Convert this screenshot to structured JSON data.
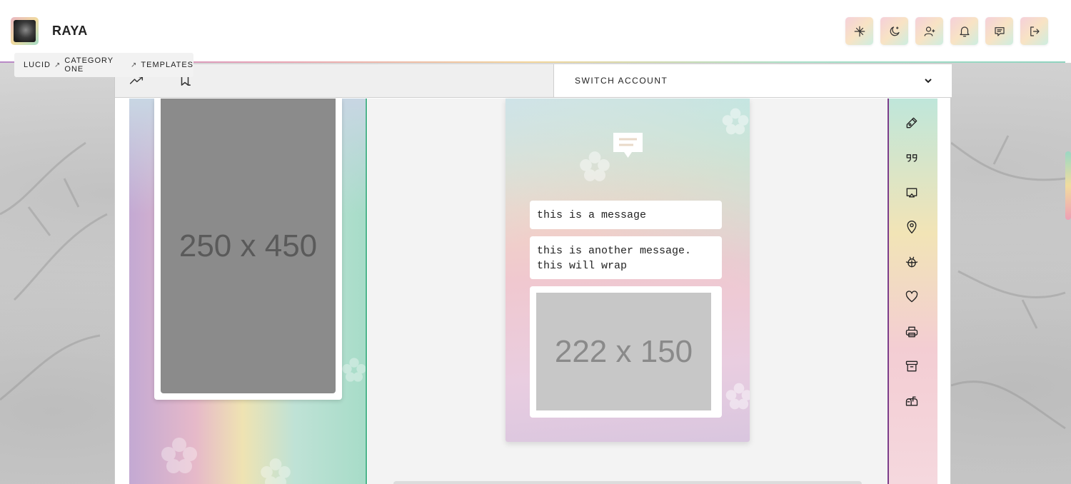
{
  "header": {
    "brand": "RAYA",
    "icons": [
      "cursor-sparkle-icon",
      "moon-star-icon",
      "user-add-icon",
      "bell-icon",
      "message-icon",
      "logout-icon"
    ]
  },
  "breadcrumb": {
    "items": [
      "LUCID",
      "CATEGORY ONE",
      "TEMPLATES"
    ],
    "separator": "↗"
  },
  "tabs": {
    "icons": [
      "trending-icon",
      "bookmark-icon"
    ]
  },
  "switch_account": {
    "label": "SWITCH ACCOUNT"
  },
  "left_preview": {
    "placeholder": "250 x 450"
  },
  "phone": {
    "messages": [
      "this is a message",
      "this is another message. this will wrap"
    ],
    "image_placeholder": "222 x 150"
  },
  "toolbar": {
    "icons": [
      "pen-icon",
      "quote-icon",
      "cast-icon",
      "map-pin-icon",
      "bug-icon",
      "heart-icon",
      "printer-icon",
      "archive-icon",
      "mailbox-icon"
    ]
  },
  "colors": {
    "accent_green": "#4fb48c",
    "accent_purple": "#7b3d8a"
  }
}
